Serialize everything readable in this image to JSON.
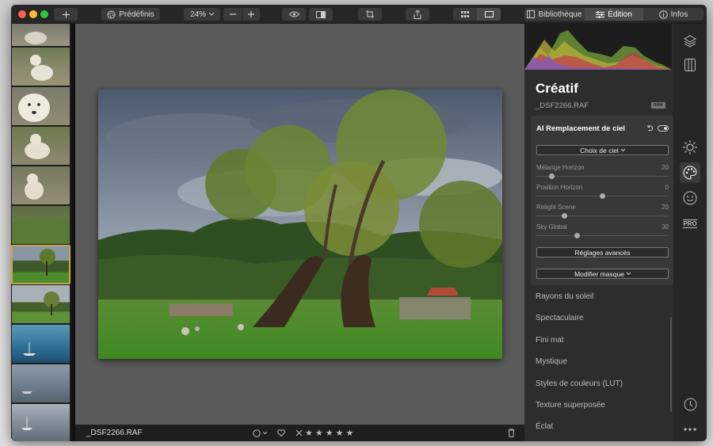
{
  "toolbar": {
    "presets_label": "Prédéfinis",
    "zoom_label": "24%",
    "tab_library": "Bibliothèque",
    "tab_edit": "Édition",
    "tab_info": "Infos"
  },
  "canvas": {
    "filename": "_DSF2266.RAF"
  },
  "panel": {
    "title": "Créatif",
    "filename": "_DSF2266.RAF",
    "raw_badge": "RAW",
    "tool": {
      "title": "AI Remplacement de ciel",
      "sky_choice": "Choix de ciel",
      "sliders": [
        {
          "label": "Mélange Horizon",
          "value": "20",
          "fraction": 0.1
        },
        {
          "label": "Position Horizon",
          "value": "0",
          "fraction": 0.5
        },
        {
          "label": "Relight Scene",
          "value": "20",
          "fraction": 0.2
        },
        {
          "label": "Sky Global",
          "value": "30",
          "fraction": 0.3
        }
      ],
      "advanced_button": "Réglages avancés",
      "mask_button": "Modifier masque"
    },
    "sections": [
      "Rayons du soleil",
      "Spectaculaire",
      "Fini mat",
      "Mystique",
      "Styles de couleurs (LUT)",
      "Texture superposée",
      "Éclat"
    ]
  },
  "rail": {
    "pro_label": "PRO"
  },
  "colors": {
    "accent_selected": "#c9a64b",
    "panel_bg": "#2d2d2d",
    "canvas_bg": "#5a5a5a"
  }
}
